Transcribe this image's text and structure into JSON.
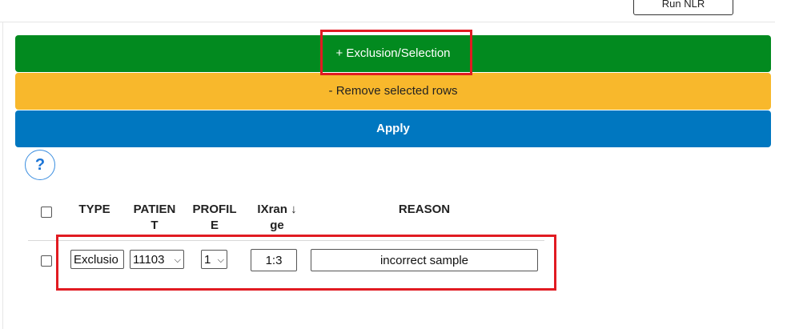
{
  "top": {
    "run_button_label": "Run NLR"
  },
  "actions": {
    "add_label": "+ Exclusion/Selection",
    "remove_label": "- Remove selected rows",
    "apply_label": "Apply"
  },
  "help": {
    "label": "?"
  },
  "table": {
    "headers": {
      "type": "TYPE",
      "patient": "PATIEN\nT",
      "profile": "PROFIL\nE",
      "ixrange": "IXran ↓\nge",
      "reason": "REASON"
    },
    "rows": [
      {
        "type": "Exclusio",
        "patient": "11103",
        "profile": "1",
        "ixrange": "1:3",
        "reason": "incorrect sample"
      }
    ]
  },
  "colors": {
    "add_bar": "#028a1f",
    "remove_bar": "#f8b82c",
    "apply_bar": "#0077c0",
    "highlight": "#e11b22"
  }
}
